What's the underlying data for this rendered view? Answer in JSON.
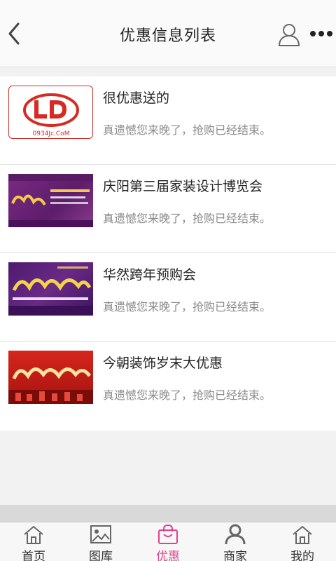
{
  "header": {
    "title": "优惠信息列表"
  },
  "items": [
    {
      "title": "很优惠送的",
      "status": "真遗憾您来晚了，抢购已经结束。",
      "logo_url_text": "0934Jc.CoM"
    },
    {
      "title": "庆阳第三届家装设计博览会",
      "status": "真遗憾您来晚了，抢购已经结束。"
    },
    {
      "title": "华然跨年预购会",
      "status": "真遗憾您来晚了，抢购已经结束。"
    },
    {
      "title": "今朝装饰岁末大优惠",
      "status": "真遗憾您来晚了，抢购已经结束。"
    }
  ],
  "tabs": [
    {
      "label": "首页",
      "icon": "home-icon"
    },
    {
      "label": "图库",
      "icon": "gallery-icon"
    },
    {
      "label": "优惠",
      "icon": "shopping-bag-icon",
      "active": true
    },
    {
      "label": "商家",
      "icon": "merchant-icon"
    },
    {
      "label": "我的",
      "icon": "home-icon"
    }
  ],
  "colors": {
    "accent": "#e0438b",
    "text": "#222222",
    "muted": "#8a8a8a"
  }
}
